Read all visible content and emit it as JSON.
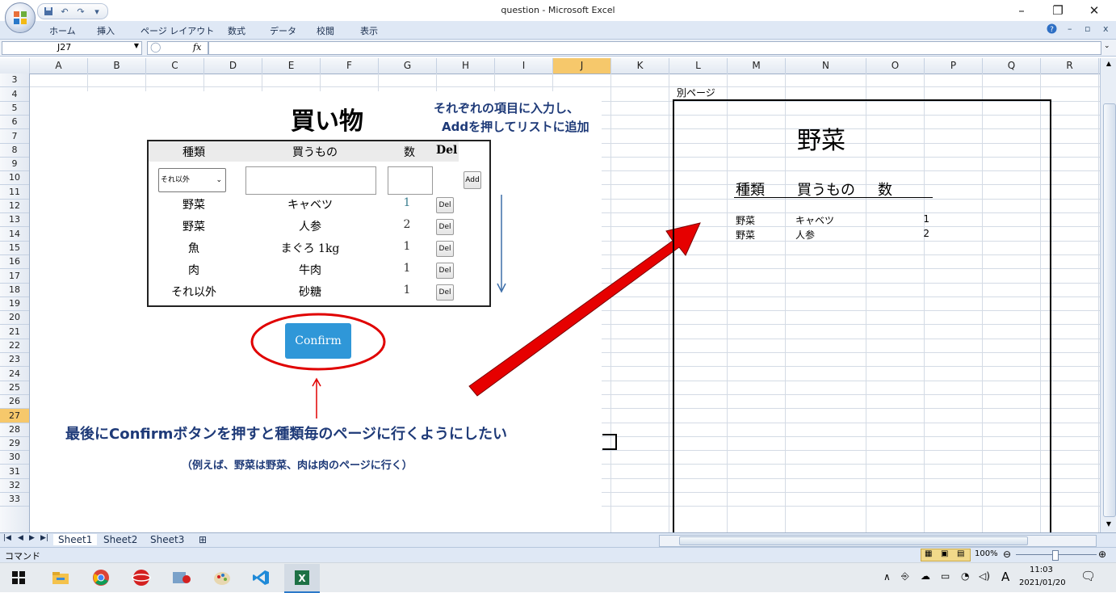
{
  "window": {
    "title": "question - Microsoft Excel"
  },
  "ribbon": {
    "tabs": [
      "ホーム",
      "挿入",
      "ページ レイアウト",
      "数式",
      "データ",
      "校閲",
      "表示"
    ]
  },
  "formula_bar": {
    "name_box": "J27",
    "fx_label": "fx",
    "value": ""
  },
  "grid": {
    "columns": [
      "A",
      "B",
      "C",
      "D",
      "E",
      "F",
      "G",
      "H",
      "I",
      "J",
      "K",
      "L",
      "M",
      "N",
      "O",
      "P",
      "Q",
      "R"
    ],
    "rows": [
      "3",
      "4",
      "5",
      "6",
      "7",
      "8",
      "9",
      "10",
      "11",
      "12",
      "13",
      "14",
      "15",
      "16",
      "17",
      "18",
      "19",
      "20",
      "21",
      "22",
      "23",
      "24",
      "25",
      "26",
      "27",
      "28",
      "29",
      "30",
      "31",
      "32",
      "33"
    ],
    "selected_row": "27",
    "selected_col": "J"
  },
  "overlay": {
    "heading": "買い物",
    "instruction_line1": "それぞれの項目に入力し、",
    "instruction_line2": "Addを押してリストに追加",
    "table_headers": [
      "種類",
      "買うもの",
      "数",
      "Del"
    ],
    "select_value": "それ以外",
    "add_button": "Add",
    "items": [
      {
        "type": "野菜",
        "name": "キャベツ",
        "qty": "1",
        "del": "Del"
      },
      {
        "type": "野菜",
        "name": "人参",
        "qty": "2",
        "del": "Del"
      },
      {
        "type": "魚",
        "name": "まぐろ 1kg",
        "qty": "1",
        "del": "Del"
      },
      {
        "type": "肉",
        "name": "牛肉",
        "qty": "1",
        "del": "Del"
      },
      {
        "type": "それ以外",
        "name": "砂糖",
        "qty": "1",
        "del": "Del"
      }
    ],
    "confirm_button": "Confirm",
    "caption_line1": "最後にConfirmボタンを押すと種類毎のページに行くようにしたい",
    "caption_line2": "（例えば、野菜は野菜、肉は肉のページに行く）"
  },
  "right_page": {
    "label": "別ページ",
    "title": "野菜",
    "headers": [
      "種類",
      "買うもの",
      "数"
    ],
    "rows": [
      {
        "type": "野菜",
        "name": "キャベツ",
        "qty": "1"
      },
      {
        "type": "野菜",
        "name": "人参",
        "qty": "2"
      }
    ]
  },
  "sheet_tabs": [
    "Sheet1",
    "Sheet2",
    "Sheet3"
  ],
  "status": {
    "mode": "コマンド",
    "zoom": "100%"
  },
  "taskbar": {
    "time": "11:03",
    "date": "2021/01/20",
    "ime": "A"
  },
  "colors": {
    "arrow": "#e60000",
    "ellipse": "#e00000",
    "confirm": "#2f97d8",
    "blue_text": "#1e3a78"
  }
}
